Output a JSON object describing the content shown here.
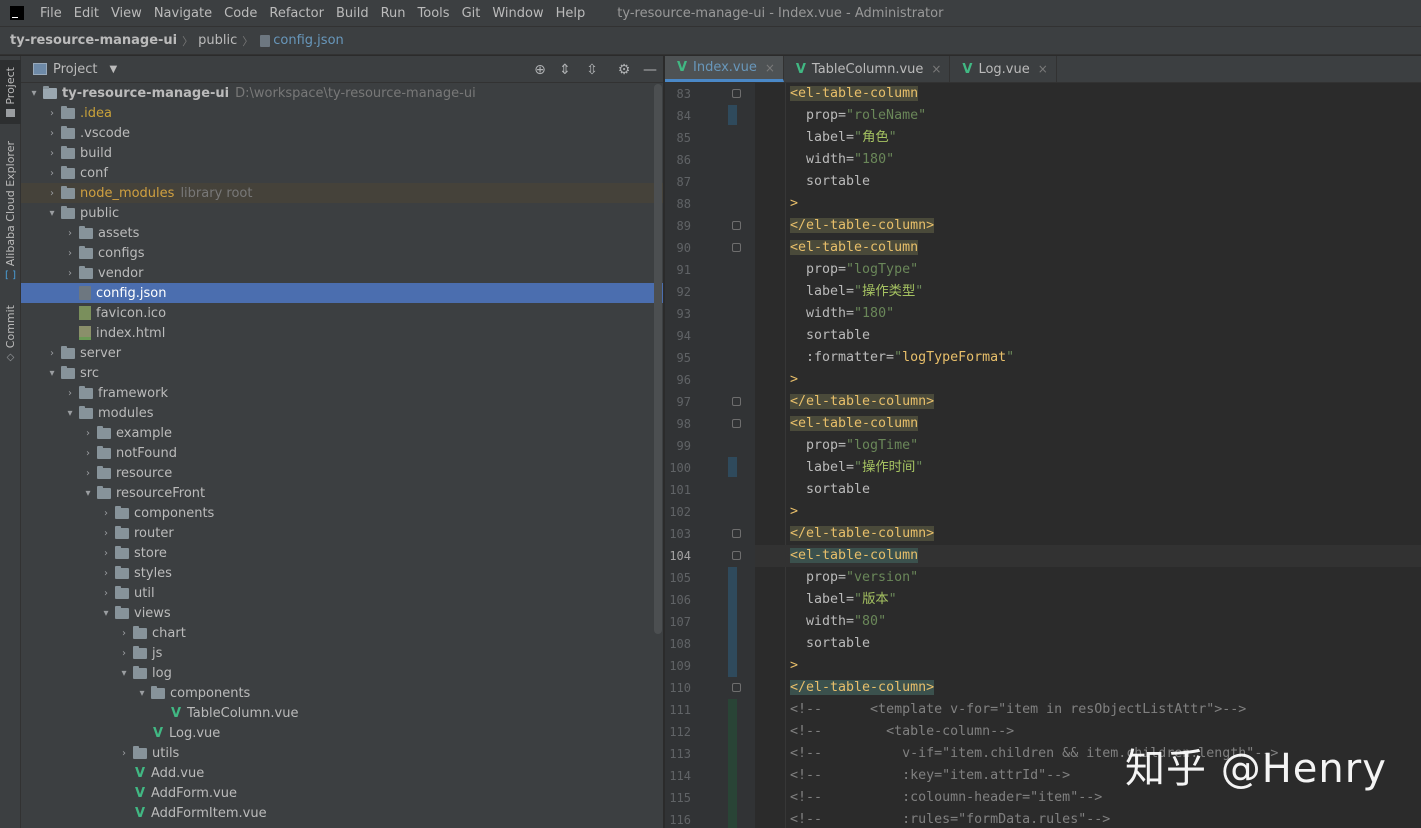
{
  "menu": {
    "items": [
      "File",
      "Edit",
      "View",
      "Navigate",
      "Code",
      "Refactor",
      "Build",
      "Run",
      "Tools",
      "Git",
      "Window",
      "Help"
    ],
    "window_title": "ty-resource-manage-ui - Index.vue - Administrator"
  },
  "breadcrumb": {
    "project": "ty-resource-manage-ui",
    "folder": "public",
    "file": "config.json"
  },
  "tool_strip": {
    "project": "Project",
    "cloud": "Alibaba Cloud Explorer",
    "commit": "Commit"
  },
  "project_panel": {
    "title": "Project",
    "dropdown": "▼",
    "locate_icon": "⊕",
    "expand_icon": "⇕",
    "collapse_icon": "⇳",
    "settings_icon": "⚙",
    "hide_icon": "—",
    "tree": [
      {
        "depth": 0,
        "arrow": "▾",
        "icon": "root",
        "name": "ty-resource-manage-ui",
        "hint": "D:\\workspace\\ty-resource-manage-ui",
        "style": "root"
      },
      {
        "depth": 1,
        "arrow": "›",
        "icon": "folder",
        "name": ".idea",
        "hint": "",
        "style": "idea"
      },
      {
        "depth": 1,
        "arrow": "›",
        "icon": "folder",
        "name": ".vscode",
        "hint": "",
        "style": ""
      },
      {
        "depth": 1,
        "arrow": "›",
        "icon": "folder",
        "name": "build",
        "hint": "",
        "style": ""
      },
      {
        "depth": 1,
        "arrow": "›",
        "icon": "folder",
        "name": "conf",
        "hint": "",
        "style": ""
      },
      {
        "depth": 1,
        "arrow": "›",
        "icon": "folder",
        "name": "node_modules",
        "hint": "library root",
        "style": "library"
      },
      {
        "depth": 1,
        "arrow": "▾",
        "icon": "folder",
        "name": "public",
        "hint": "",
        "style": ""
      },
      {
        "depth": 2,
        "arrow": "›",
        "icon": "folder",
        "name": "assets",
        "hint": "",
        "style": ""
      },
      {
        "depth": 2,
        "arrow": "›",
        "icon": "folder",
        "name": "configs",
        "hint": "",
        "style": ""
      },
      {
        "depth": 2,
        "arrow": "›",
        "icon": "folder",
        "name": "vendor",
        "hint": "",
        "style": ""
      },
      {
        "depth": 2,
        "arrow": "",
        "icon": "json",
        "name": "config.json",
        "hint": "",
        "style": "selected"
      },
      {
        "depth": 2,
        "arrow": "",
        "icon": "ico",
        "name": "favicon.ico",
        "hint": "",
        "style": ""
      },
      {
        "depth": 2,
        "arrow": "",
        "icon": "html",
        "name": "index.html",
        "hint": "",
        "style": ""
      },
      {
        "depth": 1,
        "arrow": "›",
        "icon": "folder",
        "name": "server",
        "hint": "",
        "style": ""
      },
      {
        "depth": 1,
        "arrow": "▾",
        "icon": "folder",
        "name": "src",
        "hint": "",
        "style": ""
      },
      {
        "depth": 2,
        "arrow": "›",
        "icon": "folder",
        "name": "framework",
        "hint": "",
        "style": ""
      },
      {
        "depth": 2,
        "arrow": "▾",
        "icon": "folder",
        "name": "modules",
        "hint": "",
        "style": ""
      },
      {
        "depth": 3,
        "arrow": "›",
        "icon": "folder",
        "name": "example",
        "hint": "",
        "style": ""
      },
      {
        "depth": 3,
        "arrow": "›",
        "icon": "folder",
        "name": "notFound",
        "hint": "",
        "style": ""
      },
      {
        "depth": 3,
        "arrow": "›",
        "icon": "folder",
        "name": "resource",
        "hint": "",
        "style": ""
      },
      {
        "depth": 3,
        "arrow": "▾",
        "icon": "folder",
        "name": "resourceFront",
        "hint": "",
        "style": ""
      },
      {
        "depth": 4,
        "arrow": "›",
        "icon": "folder",
        "name": "components",
        "hint": "",
        "style": ""
      },
      {
        "depth": 4,
        "arrow": "›",
        "icon": "folder",
        "name": "router",
        "hint": "",
        "style": ""
      },
      {
        "depth": 4,
        "arrow": "›",
        "icon": "folder",
        "name": "store",
        "hint": "",
        "style": ""
      },
      {
        "depth": 4,
        "arrow": "›",
        "icon": "folder",
        "name": "styles",
        "hint": "",
        "style": ""
      },
      {
        "depth": 4,
        "arrow": "›",
        "icon": "folder",
        "name": "util",
        "hint": "",
        "style": ""
      },
      {
        "depth": 4,
        "arrow": "▾",
        "icon": "folder",
        "name": "views",
        "hint": "",
        "style": ""
      },
      {
        "depth": 5,
        "arrow": "›",
        "icon": "folder",
        "name": "chart",
        "hint": "",
        "style": ""
      },
      {
        "depth": 5,
        "arrow": "›",
        "icon": "folder",
        "name": "js",
        "hint": "",
        "style": ""
      },
      {
        "depth": 5,
        "arrow": "▾",
        "icon": "folder",
        "name": "log",
        "hint": "",
        "style": ""
      },
      {
        "depth": 6,
        "arrow": "▾",
        "icon": "folder",
        "name": "components",
        "hint": "",
        "style": ""
      },
      {
        "depth": 7,
        "arrow": "",
        "icon": "vue",
        "name": "TableColumn.vue",
        "hint": "",
        "style": ""
      },
      {
        "depth": 6,
        "arrow": "",
        "icon": "vue",
        "name": "Log.vue",
        "hint": "",
        "style": ""
      },
      {
        "depth": 5,
        "arrow": "›",
        "icon": "folder",
        "name": "utils",
        "hint": "",
        "style": ""
      },
      {
        "depth": 5,
        "arrow": "",
        "icon": "vue",
        "name": "Add.vue",
        "hint": "",
        "style": ""
      },
      {
        "depth": 5,
        "arrow": "",
        "icon": "vue",
        "name": "AddForm.vue",
        "hint": "",
        "style": ""
      },
      {
        "depth": 5,
        "arrow": "",
        "icon": "vue",
        "name": "AddFormItem.vue",
        "hint": "",
        "style": ""
      }
    ]
  },
  "editor": {
    "tabs": [
      {
        "label": "Index.vue",
        "active": true
      },
      {
        "label": "TableColumn.vue",
        "active": false
      },
      {
        "label": "Log.vue",
        "active": false
      }
    ],
    "tab_close": "×",
    "current_line": 104,
    "lines": [
      {
        "n": 83,
        "indent": 0,
        "segs": [
          [
            "tag",
            "<el-table-column"
          ]
        ]
      },
      {
        "n": 84,
        "indent": 2,
        "segs": [
          [
            "attr",
            "prop="
          ],
          [
            "str",
            "\"roleName\""
          ]
        ]
      },
      {
        "n": 85,
        "indent": 2,
        "segs": [
          [
            "attr",
            "label="
          ],
          [
            "str",
            "\""
          ],
          [
            "chn",
            "角色"
          ],
          [
            "str",
            "\""
          ]
        ]
      },
      {
        "n": 86,
        "indent": 2,
        "segs": [
          [
            "attr",
            "width="
          ],
          [
            "str",
            "\"180\""
          ]
        ]
      },
      {
        "n": 87,
        "indent": 2,
        "segs": [
          [
            "attr",
            "sortable"
          ]
        ]
      },
      {
        "n": 88,
        "indent": 0,
        "segs": [
          [
            "tag",
            ">"
          ]
        ]
      },
      {
        "n": 89,
        "indent": 0,
        "segs": [
          [
            "tag",
            "</el-table-column>"
          ]
        ]
      },
      {
        "n": 90,
        "indent": 0,
        "segs": [
          [
            "tag",
            "<el-table-column"
          ]
        ]
      },
      {
        "n": 91,
        "indent": 2,
        "segs": [
          [
            "attr",
            "prop="
          ],
          [
            "str",
            "\"logType\""
          ]
        ]
      },
      {
        "n": 92,
        "indent": 2,
        "segs": [
          [
            "attr",
            "label="
          ],
          [
            "str",
            "\""
          ],
          [
            "chn",
            "操作类型"
          ],
          [
            "str",
            "\""
          ]
        ]
      },
      {
        "n": 93,
        "indent": 2,
        "segs": [
          [
            "attr",
            "width="
          ],
          [
            "str",
            "\"180\""
          ]
        ]
      },
      {
        "n": 94,
        "indent": 2,
        "segs": [
          [
            "attr",
            "sortable"
          ]
        ]
      },
      {
        "n": 95,
        "indent": 2,
        "segs": [
          [
            "attr",
            ":formatter="
          ],
          [
            "str",
            "\""
          ],
          [
            "tag",
            "logTypeFormat"
          ],
          [
            "str",
            "\""
          ]
        ]
      },
      {
        "n": 96,
        "indent": 0,
        "segs": [
          [
            "tag",
            ">"
          ]
        ]
      },
      {
        "n": 97,
        "indent": 0,
        "segs": [
          [
            "tag",
            "</el-table-column>"
          ]
        ]
      },
      {
        "n": 98,
        "indent": 0,
        "segs": [
          [
            "tag",
            "<el-table-column"
          ]
        ]
      },
      {
        "n": 99,
        "indent": 2,
        "segs": [
          [
            "attr",
            "prop="
          ],
          [
            "str",
            "\"logTime\""
          ]
        ]
      },
      {
        "n": 100,
        "indent": 2,
        "segs": [
          [
            "attr",
            "label="
          ],
          [
            "str",
            "\""
          ],
          [
            "chn",
            "操作时间"
          ],
          [
            "str",
            "\""
          ]
        ]
      },
      {
        "n": 101,
        "indent": 2,
        "segs": [
          [
            "attr",
            "sortable"
          ]
        ]
      },
      {
        "n": 102,
        "indent": 0,
        "segs": [
          [
            "tag",
            ">"
          ]
        ]
      },
      {
        "n": 103,
        "indent": 0,
        "segs": [
          [
            "tag",
            "</el-table-column>"
          ]
        ]
      },
      {
        "n": 104,
        "indent": 0,
        "segs": [
          [
            "tag",
            "<el-table-column"
          ]
        ]
      },
      {
        "n": 105,
        "indent": 2,
        "segs": [
          [
            "attr",
            "prop="
          ],
          [
            "str",
            "\"version\""
          ]
        ]
      },
      {
        "n": 106,
        "indent": 2,
        "segs": [
          [
            "attr",
            "label="
          ],
          [
            "str",
            "\""
          ],
          [
            "chn",
            "版本"
          ],
          [
            "str",
            "\""
          ]
        ]
      },
      {
        "n": 107,
        "indent": 2,
        "segs": [
          [
            "attr",
            "width="
          ],
          [
            "str",
            "\"80\""
          ]
        ]
      },
      {
        "n": 108,
        "indent": 2,
        "segs": [
          [
            "attr",
            "sortable"
          ]
        ]
      },
      {
        "n": 109,
        "indent": 0,
        "segs": [
          [
            "tag",
            ">"
          ]
        ]
      },
      {
        "n": 110,
        "indent": 0,
        "segs": [
          [
            "tag",
            "</el-table-column>"
          ]
        ]
      },
      {
        "n": 111,
        "indent": 0,
        "segs": [
          [
            "cmt",
            "<!--      <template v-for=\"item in resObjectListAttr\">-->"
          ]
        ]
      },
      {
        "n": 112,
        "indent": 0,
        "segs": [
          [
            "cmt",
            "<!--        <table-column-->"
          ]
        ]
      },
      {
        "n": 113,
        "indent": 0,
        "segs": [
          [
            "cmt",
            "<!--          v-if=\"item.children && item.children.length\"-->"
          ]
        ]
      },
      {
        "n": 114,
        "indent": 0,
        "segs": [
          [
            "cmt",
            "<!--          :key=\"item.attrId\"-->"
          ]
        ]
      },
      {
        "n": 115,
        "indent": 0,
        "segs": [
          [
            "cmt",
            "<!--          :coloumn-header=\"item\"-->"
          ]
        ]
      },
      {
        "n": 116,
        "indent": 0,
        "segs": [
          [
            "cmt",
            "<!--          :rules=\"formData.rules\"-->"
          ]
        ]
      }
    ]
  },
  "watermark": "知乎 @Henry"
}
